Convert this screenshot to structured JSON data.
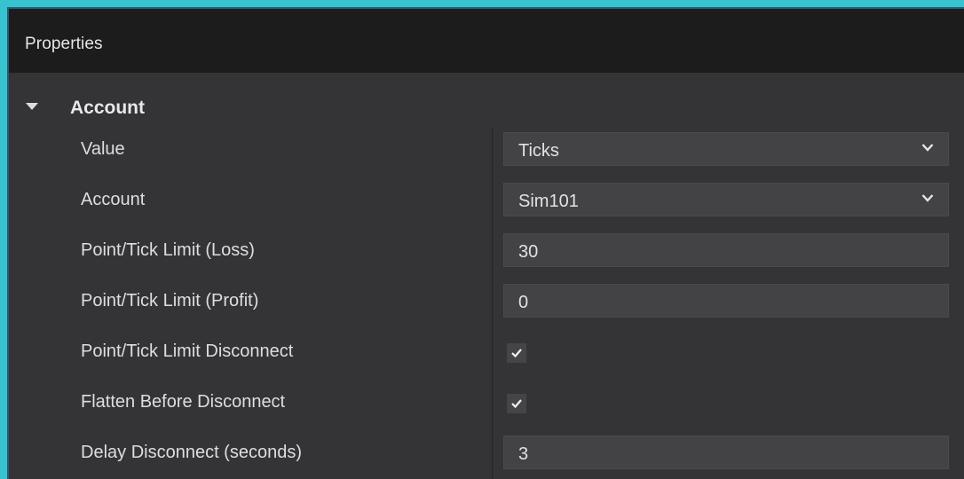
{
  "panel": {
    "title": "Properties"
  },
  "section": {
    "label": "Account",
    "expanded": true,
    "icon": "caret-down-icon"
  },
  "properties": [
    {
      "label": "Value",
      "type": "dropdown",
      "value": "Ticks"
    },
    {
      "label": "Account",
      "type": "dropdown",
      "value": "Sim101"
    },
    {
      "label": "Point/Tick Limit (Loss)",
      "type": "text",
      "value": "30"
    },
    {
      "label": "Point/Tick Limit (Profit)",
      "type": "text",
      "value": "0"
    },
    {
      "label": "Point/Tick Limit Disconnect",
      "type": "checkbox",
      "checked": true
    },
    {
      "label": "Flatten Before Disconnect",
      "type": "checkbox",
      "checked": true
    },
    {
      "label": "Delay Disconnect (seconds)",
      "type": "text",
      "value": "3"
    }
  ],
  "colors": {
    "window_border": "#36c3cf",
    "panel_background": "#343436",
    "header_background": "#1c1c1d",
    "field_background": "#434346",
    "text": "#dedede"
  }
}
